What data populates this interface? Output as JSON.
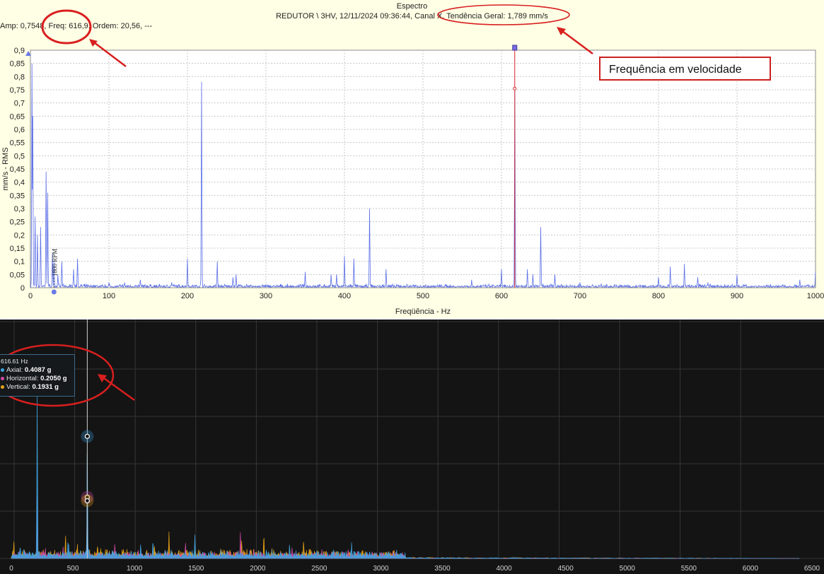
{
  "top_chart": {
    "title": "Espectro",
    "subtitle": "REDUTOR \\ 3HV, 12/11/2024 09:36:44, Canal X, Tendência Geral: 1,789 mm/s",
    "readout": "Amp: 0,7548, Freq: 616,9, Ordem: 20,56, ---",
    "callout": "Frequência em velocidade",
    "marker_label": "1800 RPM"
  },
  "bottom_chart": {
    "tooltip": {
      "header": "616.61 Hz",
      "rows": [
        {
          "label": "Axial",
          "value": "0.4087 g",
          "color": "#3fa3e0"
        },
        {
          "label": "Horizontal",
          "value": "0.2050 g",
          "color": "#d24aa6"
        },
        {
          "label": "Vertical",
          "value": "0.1931 g",
          "color": "#e8a316"
        }
      ]
    }
  },
  "chart_data": [
    {
      "type": "line",
      "title": "Espectro",
      "xlabel": "Freqüência - Hz",
      "ylabel": "mm/s - RMS",
      "xlim": [
        0,
        1000
      ],
      "ylim": [
        0,
        0.9
      ],
      "x_ticks": [
        "0",
        "100",
        "200",
        "300",
        "400",
        "500",
        "600",
        "700",
        "800",
        "900",
        "1000"
      ],
      "y_ticks": [
        "0",
        "0,05",
        "0,1",
        "0,15",
        "0,2",
        "0,25",
        "0,3",
        "0,35",
        "0,4",
        "0,45",
        "0,5",
        "0,55",
        "0,6",
        "0,65",
        "0,7",
        "0,75",
        "0,8",
        "0,85",
        "0,9"
      ],
      "grid": true,
      "cursor_x": 616.9,
      "cursor_amp": 0.7548,
      "color": "#5a6ee6",
      "series": [
        {
          "peaks": [
            [
              2,
              0.85
            ],
            [
              3,
              0.65
            ],
            [
              6,
              0.27
            ],
            [
              9,
              0.2
            ],
            [
              13,
              0.23
            ],
            [
              20,
              0.44
            ],
            [
              22,
              0.36
            ],
            [
              28,
              0.13
            ],
            [
              30,
              0.1
            ],
            [
              35,
              0.05
            ],
            [
              40,
              0.1
            ],
            [
              55,
              0.07
            ],
            [
              60,
              0.11
            ],
            [
              100,
              0.02
            ],
            [
              120,
              0.02
            ],
            [
              140,
              0.03
            ],
            [
              180,
              0.02
            ],
            [
              200,
              0.11
            ],
            [
              218,
              0.78
            ],
            [
              238,
              0.1
            ],
            [
              258,
              0.04
            ],
            [
              262,
              0.05
            ],
            [
              350,
              0.06
            ],
            [
              383,
              0.05
            ],
            [
              390,
              0.05
            ],
            [
              400,
              0.12
            ],
            [
              412,
              0.11
            ],
            [
              432,
              0.3
            ],
            [
              453,
              0.07
            ],
            [
              562,
              0.03
            ],
            [
              600,
              0.07
            ],
            [
              617,
              0.7548
            ],
            [
              633,
              0.07
            ],
            [
              640,
              0.05
            ],
            [
              650,
              0.23
            ],
            [
              668,
              0.05
            ],
            [
              700,
              0.02
            ],
            [
              800,
              0.04
            ],
            [
              815,
              0.08
            ],
            [
              833,
              0.09
            ],
            [
              850,
              0.04
            ],
            [
              863,
              0.02
            ],
            [
              900,
              0.05
            ],
            [
              980,
              0.03
            ],
            [
              1000,
              0.06
            ]
          ]
        }
      ]
    },
    {
      "type": "line",
      "xlim": [
        0,
        6500
      ],
      "ylim": [
        0,
        0.8
      ],
      "x_ticks": [
        "0",
        "500",
        "1000",
        "1500",
        "2000",
        "2500",
        "3000",
        "3500",
        "4000",
        "4500",
        "5000",
        "5500",
        "6000",
        "6500"
      ],
      "grid": true,
      "cursor_x": 616.61,
      "series": [
        {
          "name": "Axial",
          "color": "#3fa3e0",
          "peaks": [
            [
              100,
              0.03
            ],
            [
              210,
              0.57
            ],
            [
              460,
              0.06
            ],
            [
              616.61,
              0.4087
            ],
            [
              820,
              0.03
            ],
            [
              1050,
              0.05
            ],
            [
              1150,
              0.06
            ],
            [
              1400,
              0.02
            ],
            [
              1490,
              0.08
            ],
            [
              1700,
              0.03
            ],
            [
              1830,
              0.02
            ],
            [
              2070,
              0.03
            ],
            [
              2230,
              0.02
            ],
            [
              2480,
              0.03
            ],
            [
              2600,
              0.02
            ]
          ]
        },
        {
          "name": "Horizontal",
          "color": "#d24aa6",
          "peaks": [
            [
              210,
              0.21
            ],
            [
              420,
              0.04
            ],
            [
              616.61,
              0.205
            ],
            [
              840,
              0.05
            ],
            [
              1030,
              0.03
            ],
            [
              1250,
              0.03
            ],
            [
              1860,
              0.09
            ],
            [
              2300,
              0.02
            ],
            [
              2610,
              0.02
            ]
          ]
        },
        {
          "name": "Vertical",
          "color": "#e8a316",
          "peaks": [
            [
              210,
              0.05
            ],
            [
              440,
              0.08
            ],
            [
              616.61,
              0.1931
            ],
            [
              700,
              0.04
            ],
            [
              900,
              0.03
            ],
            [
              1100,
              0.03
            ],
            [
              1280,
              0.09
            ],
            [
              1870,
              0.06
            ],
            [
              2050,
              0.08
            ],
            [
              2130,
              0.03
            ],
            [
              2460,
              0.02
            ],
            [
              3050,
              0.01
            ],
            [
              3500,
              0.01
            ],
            [
              4300,
              0.005
            ]
          ]
        }
      ]
    }
  ]
}
